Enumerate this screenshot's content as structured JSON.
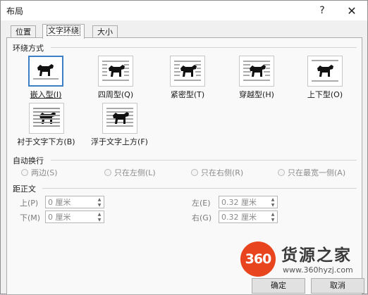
{
  "window": {
    "title": "布局",
    "help_glyph": "?",
    "close_glyph": "✕"
  },
  "tabs": [
    {
      "label": "位置",
      "active": false
    },
    {
      "label": "文字环绕",
      "active": true
    },
    {
      "label": "大小",
      "active": false
    }
  ],
  "wrap_style": {
    "heading": "环绕方式",
    "options": [
      {
        "label": "嵌入型(I)",
        "icon": "inline-icon",
        "selected": true
      },
      {
        "label": "四周型(Q)",
        "icon": "square-wrap-icon",
        "selected": false
      },
      {
        "label": "紧密型(T)",
        "icon": "tight-wrap-icon",
        "selected": false
      },
      {
        "label": "穿越型(H)",
        "icon": "through-wrap-icon",
        "selected": false
      },
      {
        "label": "上下型(O)",
        "icon": "top-bottom-wrap-icon",
        "selected": false
      },
      {
        "label": "衬于文字下方(B)",
        "icon": "behind-text-icon",
        "selected": false
      },
      {
        "label": "浮于文字上方(F)",
        "icon": "in-front-of-text-icon",
        "selected": false
      }
    ]
  },
  "wrap_text": {
    "heading": "自动换行",
    "options": [
      {
        "label": "两边(S)",
        "disabled": true
      },
      {
        "label": "只在左侧(L)",
        "disabled": true
      },
      {
        "label": "只在右侧(R)",
        "disabled": true
      },
      {
        "label": "只在最宽一侧(A)",
        "disabled": true
      }
    ]
  },
  "distance": {
    "heading": "距正文",
    "top_label": "上(P)",
    "top_value": "0 厘米",
    "bottom_label": "下(M)",
    "bottom_value": "0 厘米",
    "left_label": "左(E)",
    "left_value": "0.32 厘米",
    "right_label": "右(G)",
    "right_value": "0.32 厘米"
  },
  "buttons": {
    "ok": "确定",
    "cancel": "取消"
  },
  "watermark": {
    "logo_text": "360",
    "name": "货源之家",
    "url": "www.360hyzj.com"
  },
  "colors": {
    "selection": "#3c7fc4",
    "watermark_red": "#e8451e"
  }
}
